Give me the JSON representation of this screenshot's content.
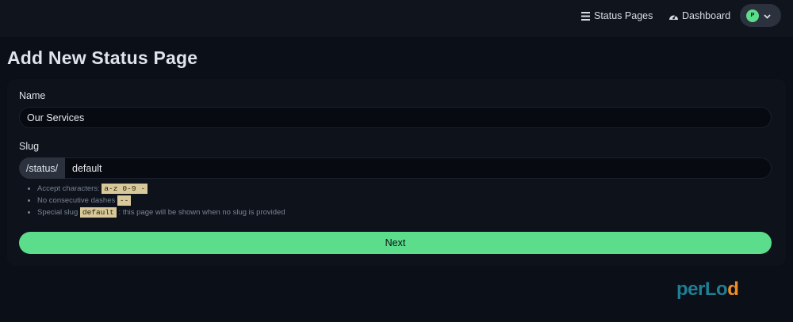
{
  "nav": {
    "status_pages_label": "Status Pages",
    "dashboard_label": "Dashboard",
    "user_initial": "P"
  },
  "page": {
    "title": "Add New Status Page"
  },
  "form": {
    "name_label": "Name",
    "name_value": "Our Services",
    "slug_label": "Slug",
    "slug_prefix": "/status/",
    "slug_value": "default",
    "hints": {
      "accept_text": "Accept characters:",
      "accept_codes": [
        "a-z",
        "0-9",
        "-"
      ],
      "dashes_text": "No consecutive dashes",
      "dashes_code": "--",
      "special_text": "Special slug",
      "special_code": "default",
      "special_suffix": ": this page will be shown when no slug is provided"
    },
    "next_label": "Next"
  },
  "watermark": {
    "part1": "per",
    "part2": "Lo",
    "part3": "d"
  },
  "colors": {
    "accent": "#5cdd8b",
    "background": "#0b0f17",
    "code_highlight": "#d9c99a"
  }
}
